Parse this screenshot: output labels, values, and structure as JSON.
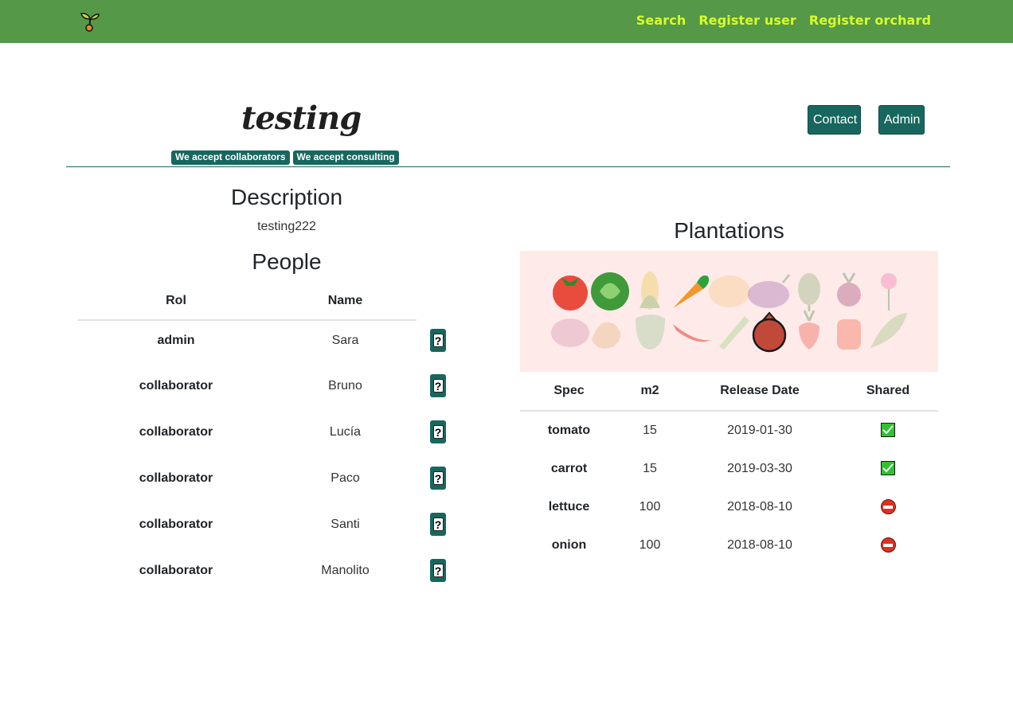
{
  "nav": {
    "brand_icon": "sprout-icon",
    "links": [
      "Search",
      "Register user",
      "Register orchard"
    ]
  },
  "header": {
    "title": "testing",
    "badges": [
      "We accept collaborators",
      "We accept consulting"
    ],
    "contact_label": "Contact",
    "admin_label": "Admin"
  },
  "description": {
    "heading": "Description",
    "text": "testing222"
  },
  "people": {
    "heading": "People",
    "columns": [
      "Rol",
      "Name"
    ],
    "rows": [
      {
        "rol": "admin",
        "name": "Sara"
      },
      {
        "rol": "collaborator",
        "name": "Bruno"
      },
      {
        "rol": "collaborator",
        "name": "Lucía"
      },
      {
        "rol": "collaborator",
        "name": "Paco"
      },
      {
        "rol": "collaborator",
        "name": "Santi"
      },
      {
        "rol": "collaborator",
        "name": "Manolito"
      }
    ],
    "help_label": "?"
  },
  "plantations": {
    "heading": "Plantations",
    "columns": [
      "Spec",
      "m2",
      "Release Date",
      "Shared"
    ],
    "rows": [
      {
        "spec": "tomato",
        "m2": "15",
        "date": "2019-01-30",
        "shared": true
      },
      {
        "spec": "carrot",
        "m2": "15",
        "date": "2019-03-30",
        "shared": true
      },
      {
        "spec": "lettuce",
        "m2": "100",
        "date": "2018-08-10",
        "shared": false
      },
      {
        "spec": "onion",
        "m2": "100",
        "date": "2018-08-10",
        "shared": false
      }
    ]
  },
  "colors": {
    "navbar": "#549848",
    "nav_link": "#d8ff27",
    "accent": "#17675e",
    "veg_panel_bg": "#ffeaea"
  }
}
